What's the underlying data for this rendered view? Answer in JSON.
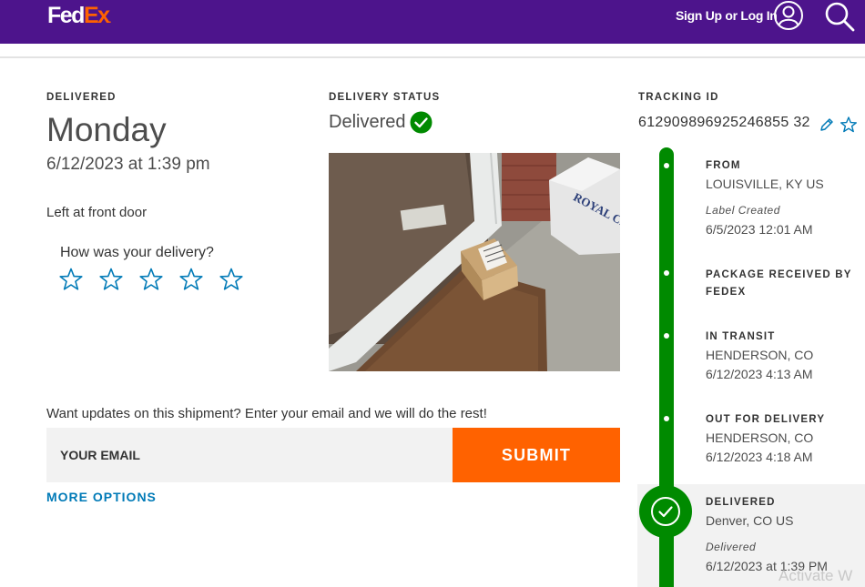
{
  "header": {
    "logo_fed": "Fed",
    "logo_ex": "Ex",
    "logo_dot": ".",
    "signin_label": "Sign Up or Log In"
  },
  "delivery": {
    "label": "DELIVERED",
    "day": "Monday",
    "datetime": "6/12/2023 at 1:39 pm",
    "note": "Left at front door",
    "rating_question": "How was your delivery?",
    "stars_count": 5
  },
  "status": {
    "label": "DELIVERY STATUS",
    "value": "Delivered",
    "photo_box_text": "ROYAL CREST"
  },
  "tracking": {
    "label": "TRACKING ID",
    "number": "612909896925246855 32"
  },
  "updates": {
    "prompt": "Want updates on this shipment? Enter your email and we will do the rest!",
    "email_placeholder": "YOUR EMAIL",
    "submit_label": "SUBMIT",
    "more_options": "MORE OPTIONS"
  },
  "timeline": [
    {
      "title": "FROM",
      "location": "LOUISVILLE, KY US",
      "event": "Label Created",
      "time": "6/5/2023 12:01 AM"
    },
    {
      "title": "PACKAGE RECEIVED BY",
      "title2": "FEDEX"
    },
    {
      "title": "IN TRANSIT",
      "location": "HENDERSON, CO",
      "time": "6/12/2023 4:13 AM"
    },
    {
      "title": "OUT FOR DELIVERY",
      "location": "HENDERSON, CO",
      "time": "6/12/2023 4:18 AM"
    },
    {
      "title": "DELIVERED",
      "location": "Denver, CO US",
      "event": "Delivered",
      "time": "6/12/2023 at 1:39 PM"
    }
  ],
  "watermark": "Activate W",
  "colors": {
    "brand_purple": "#4d148c",
    "brand_orange": "#ff6200",
    "success_green": "#008a00",
    "link_blue": "#007ab7"
  },
  "icons": [
    "user-icon",
    "search-icon",
    "check-circle-icon",
    "star-outline-icon",
    "edit-pencil-icon",
    "favorite-star-icon"
  ]
}
